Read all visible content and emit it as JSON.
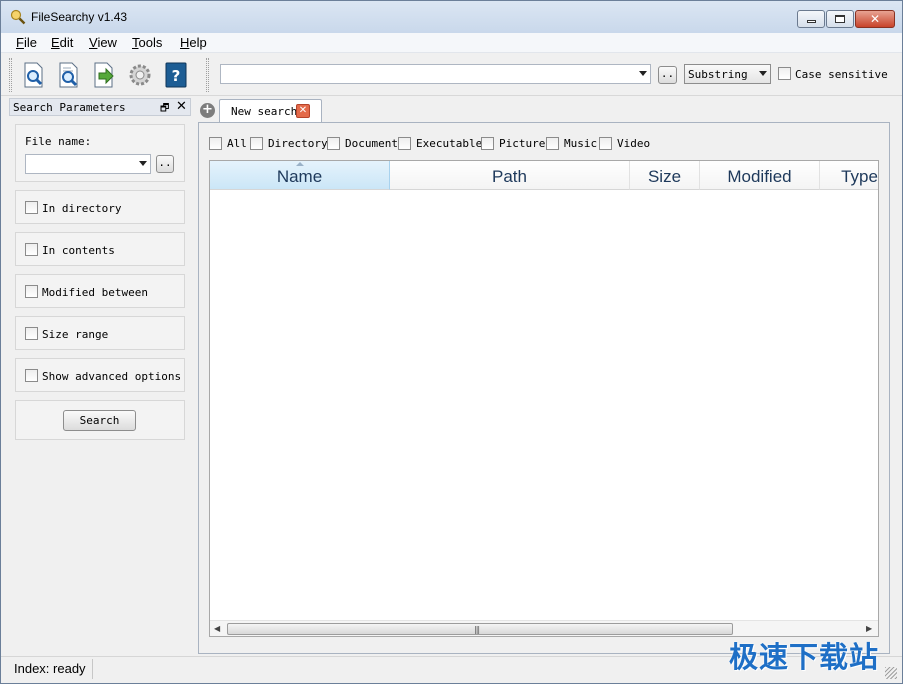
{
  "window": {
    "title": "FileSearchy v1.43"
  },
  "menu": {
    "items": [
      {
        "accel": "F",
        "rest": "ile"
      },
      {
        "accel": "E",
        "rest": "dit"
      },
      {
        "accel": "V",
        "rest": "iew"
      },
      {
        "accel": "T",
        "rest": "ools"
      },
      {
        "accel": "H",
        "rest": "elp"
      }
    ]
  },
  "toolbar": {
    "icons": [
      "search-icon",
      "search-contents-icon",
      "go-icon",
      "settings-icon",
      "help-book-icon"
    ],
    "search_value": "",
    "browse_label": "..",
    "match_mode": "Substring",
    "case_sensitive_label": "Case sensitive"
  },
  "left_panel": {
    "title": "Search Parameters",
    "file_name_label": "File name:",
    "file_name_value": "",
    "browse_label": "..",
    "in_directory": "In directory",
    "in_contents": "In contents",
    "modified_between": "Modified between",
    "size_range": "Size range",
    "show_advanced": "Show advanced options",
    "search_button": "Search"
  },
  "tabs": {
    "current": "New search"
  },
  "filters": [
    "All",
    "Directory",
    "Document",
    "Executable",
    "Picture",
    "Music",
    "Video"
  ],
  "table": {
    "columns": [
      "Name",
      "Path",
      "Size",
      "Modified",
      "Type"
    ],
    "sorted_column": "Name"
  },
  "status": {
    "text": "Index: ready"
  },
  "watermark": {
    "text": "极速下载站"
  },
  "colors": {
    "accent": "#1e6fc6",
    "header_text": "#1e395b",
    "close_button": "#c8432a"
  }
}
